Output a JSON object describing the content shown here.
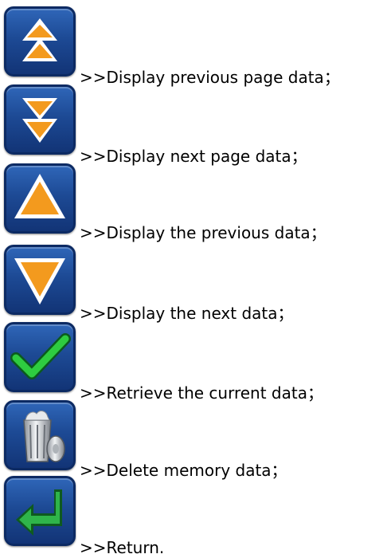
{
  "legend": [
    {
      "icon": "double-up-arrow-icon",
      "text": ">>Display previous page data；"
    },
    {
      "icon": "double-down-arrow-icon",
      "text": ">>Display next page data；"
    },
    {
      "icon": "up-arrow-icon",
      "text": ">>Display the previous data；"
    },
    {
      "icon": "down-arrow-icon",
      "text": ">>Display the next data；"
    },
    {
      "icon": "checkmark-icon",
      "text": ">>Retrieve the current data；"
    },
    {
      "icon": "trash-bin-icon",
      "text": ">>Delete memory data；"
    },
    {
      "icon": "return-arrow-icon",
      "text": ">>Return."
    }
  ],
  "colors": {
    "button_bg": "#1d4a95",
    "arrow_orange": "#f39a1e",
    "check_green": "#2ecc40",
    "return_green": "#2fb54a"
  }
}
